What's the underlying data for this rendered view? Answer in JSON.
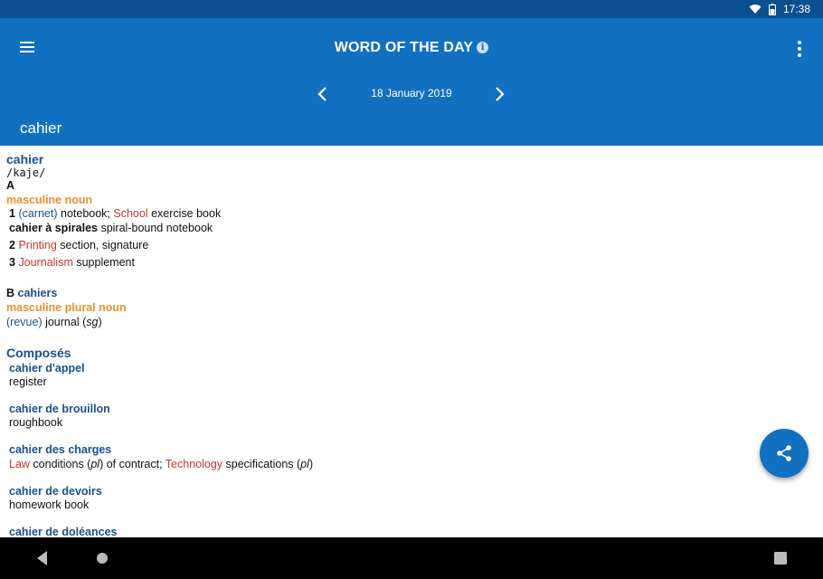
{
  "status": {
    "time": "17:38"
  },
  "header": {
    "title": "WORD OF THE DAY",
    "info_glyph": "i",
    "date": "18 January 2019",
    "word": "cahier"
  },
  "entry": {
    "headword": "cahier",
    "pron": "/kaje/",
    "sectionA": "A",
    "pos1": "masculine noun",
    "s1_num": "1",
    "s1_label": "(carnet)",
    "s1_text": " notebook; ",
    "s1_field": "School",
    "s1_text2": " exercise book",
    "phrase1": "cahier à spirales",
    "phrase1_trans": " spiral-bound notebook",
    "s2_num": "2",
    "s2_field": "Printing",
    "s2_text": " section, signature",
    "s3_num": "3",
    "s3_field": "Journalism",
    "s3_text": " supplement",
    "sectionB": "B",
    "sectionB_word": "cahiers",
    "pos2": "masculine plural noun",
    "b_label": "(revue)",
    "b_text": " journal (",
    "b_gram": "sg",
    "b_close": ")",
    "composes_title": "Composés",
    "c1_title": "cahier d'appel",
    "c1_trans": "register",
    "c2_title": "cahier de brouillon",
    "c2_trans": "roughbook",
    "c3_title": "cahier des charges",
    "c3_field1": "Law",
    "c3_text1": " conditions (",
    "c3_gram1": "pl",
    "c3_text2": ") of contract; ",
    "c3_field2": "Technology",
    "c3_text3": " specifications (",
    "c3_gram2": "pl",
    "c3_close": ")",
    "c4_title": "cahier de devoirs",
    "c4_trans": "homework book",
    "c5_title": "cahier de doléances"
  },
  "icons": {
    "menu": "hamburger-icon",
    "more": "more-vert-icon",
    "share": "share-icon"
  },
  "colors": {
    "app_bar": "#1270c0",
    "status_bar": "#0b4f8f",
    "headword": "#1d4f8c",
    "pos": "#e8902d",
    "field": "#c0392b"
  }
}
